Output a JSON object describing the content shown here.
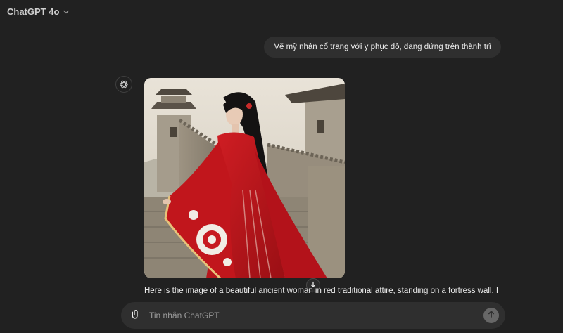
{
  "header": {
    "model_label": "ChatGPT 4o"
  },
  "user_message": {
    "text": "Vẽ mỹ nhân cổ trang với y phục đỏ, đang đứng trên thành trì"
  },
  "assistant_message": {
    "image_alt": "",
    "text": "Here is the image of a beautiful ancient woman in red traditional attire, standing on a fortress wall. I"
  },
  "composer": {
    "placeholder": "Tin nhắn ChatGPT",
    "value": ""
  },
  "icons": {
    "model_chevron": "chevron-down-icon",
    "assistant_avatar": "openai-logo-icon",
    "scroll_down": "arrow-down-icon",
    "attach": "paperclip-icon",
    "send": "arrow-up-icon"
  },
  "colors": {
    "background": "#212121",
    "bubble": "#2f2f2f",
    "send_button": "#676767",
    "dress_red": "#c0141b"
  }
}
